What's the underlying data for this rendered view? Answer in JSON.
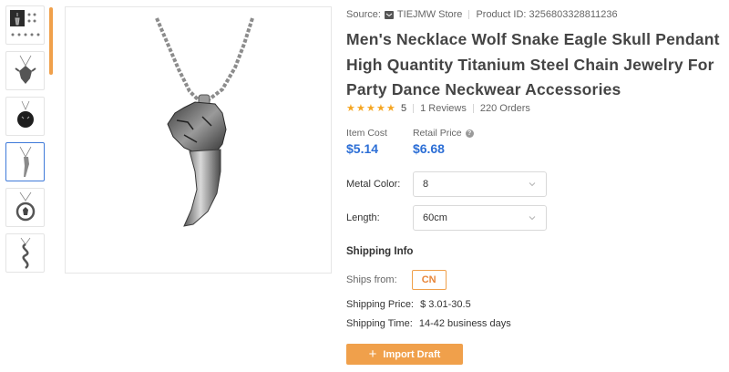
{
  "thumbnails": [
    {
      "name": "thumbnail-1-variants"
    },
    {
      "name": "thumbnail-2-eagle"
    },
    {
      "name": "thumbnail-3-wolf-black"
    },
    {
      "name": "thumbnail-4-wolf-fang"
    },
    {
      "name": "thumbnail-5-moon-wolf"
    },
    {
      "name": "thumbnail-6-snake"
    }
  ],
  "source": {
    "label": "Source:",
    "store": "TIEJMW Store",
    "product_id_label": "Product ID:",
    "product_id": "3256803328811236"
  },
  "title": "Men's Necklace Wolf Snake Eagle Skull Pendant High Quantity Titanium Steel Chain Jewelry For Party Dance Neckwear Accessories",
  "rating": {
    "stars": 5,
    "value": "5",
    "reviews": "1 Reviews",
    "orders": "220 Orders"
  },
  "prices": {
    "item_cost_label": "Item Cost",
    "item_cost": "$5.14",
    "retail_label": "Retail Price",
    "retail": "$6.68"
  },
  "options": {
    "metal_color_label": "Metal Color:",
    "metal_color_value": "8",
    "length_label": "Length:",
    "length_value": "60cm"
  },
  "shipping": {
    "title": "Shipping Info",
    "ships_from_label": "Ships from:",
    "ships_from_value": "CN",
    "price_label": "Shipping Price:",
    "price_value": "$ 3.01-30.5",
    "time_label": "Shipping Time:",
    "time_value": "14-42 business days"
  },
  "actions": {
    "import_label": "Import Draft"
  },
  "colors": {
    "accent": "#f0a04b",
    "price_blue": "#2d6fd6",
    "star": "#f5a623",
    "active_border": "#3f7ad9"
  }
}
